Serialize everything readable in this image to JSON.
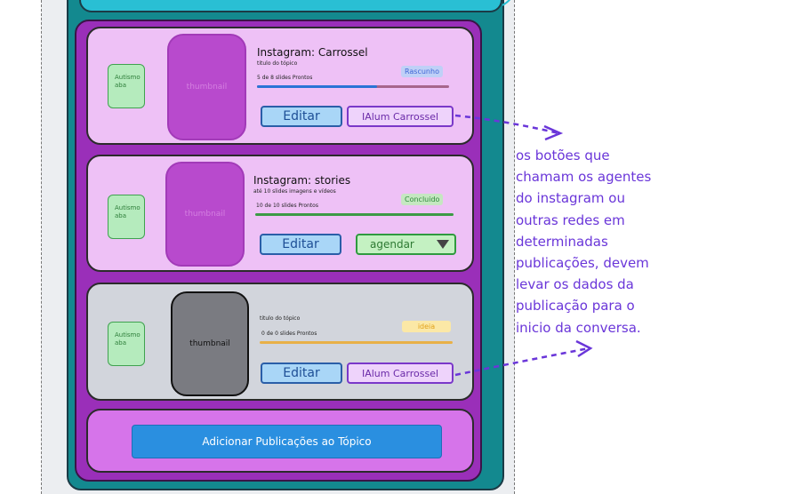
{
  "cards": [
    {
      "autism": [
        "Autismo",
        "aba"
      ],
      "thumbnail": "thumbnail",
      "title": "Instagram: Carrossel",
      "subtitle": "titulo do tópico",
      "progress_text": "5 de 8 slides Prontos",
      "progress": 0.625,
      "status": "Rascunho",
      "status_color": "#3f66d6",
      "edit_label": "Editar",
      "ai_label": "IAlum Carrossel"
    },
    {
      "autism": [
        "Autismo",
        "aba"
      ],
      "thumbnail": "thumbnail",
      "title": "Instagram: stories",
      "subtitle": "até 10 slides imagens e vídeos",
      "progress_text": "10 de 10 slides Prontos",
      "progress": 1.0,
      "status": "Concluido",
      "status_color": "#2e8a3a",
      "edit_label": "Editar",
      "select_value": "agendar"
    },
    {
      "autism": [
        "Autismo",
        "aba"
      ],
      "thumbnail": "thumbnail",
      "title": "",
      "subtitle": "titulo do tópico",
      "progress_text": "0 de 0 slides Prontos",
      "progress": 1.0,
      "status": "ideia",
      "status_color": "#e1a21b",
      "edit_label": "Editar",
      "ai_label": "IAlum Carrossel"
    }
  ],
  "add_button": "Adicionar Publicações ao Tópico",
  "annotation_lines": [
    "os botões que",
    "chamam os agentes",
    "do instagram ou",
    "outras redes em",
    "determinadas",
    "publicações, devem",
    "levar os dados da",
    "publicação para o",
    "inicio da conversa."
  ],
  "colors": {
    "accent_blue": "#2a8fe0",
    "annotation": "#6a36d9",
    "card_pink": "#eec1f6",
    "card_gray": "#d2d5dc"
  }
}
